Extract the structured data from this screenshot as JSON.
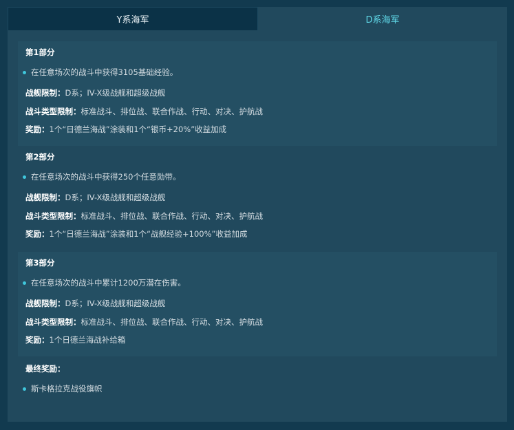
{
  "tabs": [
    {
      "label": "Y系海军",
      "active": false
    },
    {
      "label": "D系海军",
      "active": true
    }
  ],
  "parts": [
    {
      "title": "第1部分",
      "task": "在任意场次的战斗中获得3105基础经验。",
      "ship_limit_label": "战舰限制：",
      "ship_limit_value": "D系；IV-X级战舰和超级战舰",
      "battle_type_label": "战斗类型限制：",
      "battle_type_value": "标准战斗、排位战、联合作战、行动、对决、护航战",
      "reward_label": "奖励：",
      "reward_value": "1个“日德兰海战”涂装和1个“银币+20%”收益加成"
    },
    {
      "title": "第2部分",
      "task": "在任意场次的战斗中获得250个任意勋带。",
      "ship_limit_label": "战舰限制：",
      "ship_limit_value": "D系；IV-X级战舰和超级战舰",
      "battle_type_label": "战斗类型限制：",
      "battle_type_value": "标准战斗、排位战、联合作战、行动、对决、护航战",
      "reward_label": "奖励：",
      "reward_value": "1个“日德兰海战”涂装和1个“战舰经验+100%”收益加成"
    },
    {
      "title": "第3部分",
      "task": "在任意场次的战斗中累计1200万潜在伤害。",
      "ship_limit_label": "战舰限制：",
      "ship_limit_value": "D系；IV-X级战舰和超级战舰",
      "battle_type_label": "战斗类型限制：",
      "battle_type_value": "标准战斗、排位战、联合作战、行动、对决、护航战",
      "reward_label": "奖励：",
      "reward_value": "1个日德兰海战补给箱"
    }
  ],
  "final_reward": {
    "title": "最终奖励：",
    "item": "斯卡格拉克战役旗帜"
  },
  "colors": {
    "background": "#123a4f",
    "panel": "#21495d",
    "active_tab_text": "#5fd6e6",
    "bullet": "#3fc7dc"
  }
}
